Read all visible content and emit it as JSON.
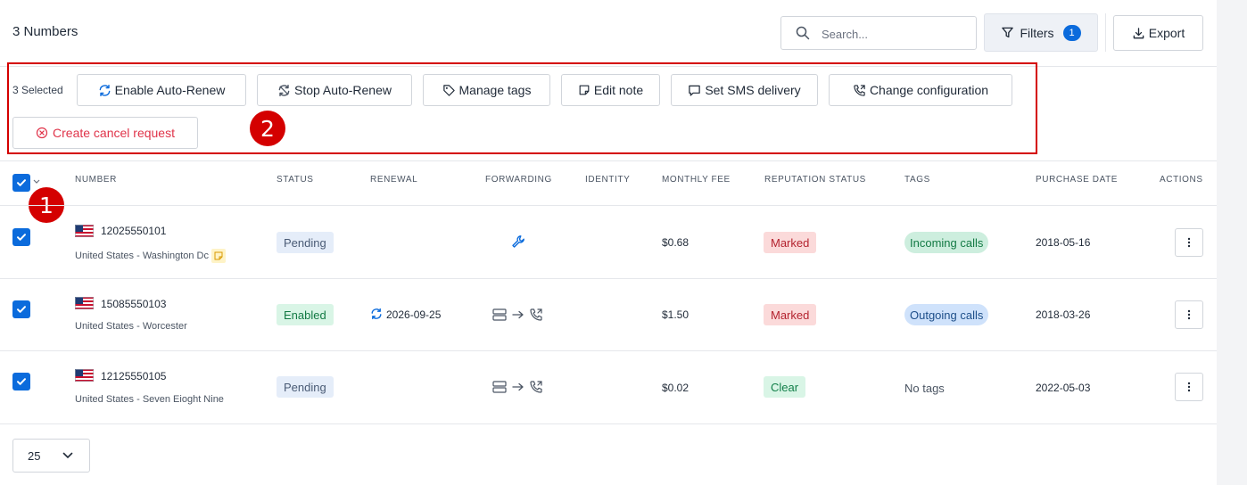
{
  "header": {
    "title": "3 Numbers",
    "search_placeholder": "Search...",
    "filters_label": "Filters",
    "filters_count": "1",
    "export_label": "Export"
  },
  "bulk": {
    "selected_label": "3 Selected",
    "actions": [
      {
        "label": "Enable Auto-Renew",
        "icon": "refresh-icon"
      },
      {
        "label": "Stop Auto-Renew",
        "icon": "stop-refresh-icon"
      },
      {
        "label": "Manage tags",
        "icon": "tag-icon"
      },
      {
        "label": "Edit note",
        "icon": "note-icon"
      },
      {
        "label": "Set SMS delivery",
        "icon": "message-icon"
      },
      {
        "label": "Change configuration",
        "icon": "phone-config-icon"
      }
    ],
    "cancel_label": "Create cancel request"
  },
  "markers": {
    "m1": "1",
    "m2": "2"
  },
  "table": {
    "columns": [
      "NUMBER",
      "STATUS",
      "RENEWAL",
      "FORWARDING",
      "IDENTITY",
      "MONTHLY FEE",
      "REPUTATION STATUS",
      "TAGS",
      "PURCHASE DATE",
      "ACTIONS"
    ],
    "rows": [
      {
        "number": "12025550101",
        "location": "United States - Washington Dc",
        "status": "Pending",
        "renewal": "",
        "forwarding": "wrench-icon",
        "identity": "",
        "fee": "$0.68",
        "reputation": "Marked",
        "tag": "Incoming calls",
        "date": "2018-05-16"
      },
      {
        "number": "15085550103",
        "location": "United States - Worcester",
        "status": "Enabled",
        "renewal": "2026-09-25",
        "forwarding": "server-to-phone-icon",
        "identity": "",
        "fee": "$1.50",
        "reputation": "Marked",
        "tag": "Outgoing calls",
        "date": "2018-03-26"
      },
      {
        "number": "12125550105",
        "location": "United States - Seven Eioght Nine",
        "status": "Pending",
        "renewal": "",
        "forwarding": "server-to-phone-icon",
        "identity": "",
        "fee": "$0.02",
        "reputation": "Clear",
        "tag": "No tags",
        "date": "2022-05-03"
      }
    ]
  },
  "pagination": {
    "page_size": "25"
  },
  "colors": {
    "accent": "#0b6bdc",
    "danger": "#d40000",
    "cancel_text": "#e0344a"
  }
}
